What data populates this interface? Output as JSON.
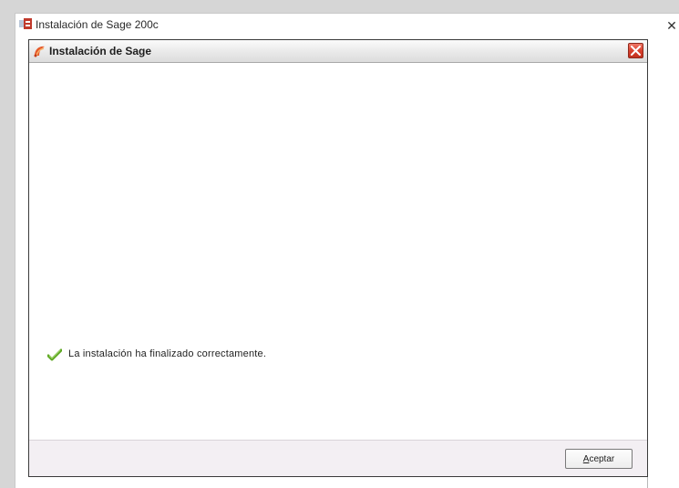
{
  "outer_window": {
    "title": "Instalación de Sage 200c",
    "close_glyph": "✕",
    "icon": "sage-installer-icon"
  },
  "dialog": {
    "title": "Instalación de Sage",
    "icon": "sage-logo-icon",
    "close_icon": "close-icon",
    "status": {
      "icon": "checkmark-icon",
      "message": "La instalación ha finalizado correctamente."
    },
    "footer": {
      "accept_button": {
        "mnemonic": "A",
        "label_rest": "ceptar"
      }
    }
  },
  "colors": {
    "close_button_red": "#d9402d",
    "check_green": "#5aa51e",
    "footer_background": "#f3eff3"
  }
}
